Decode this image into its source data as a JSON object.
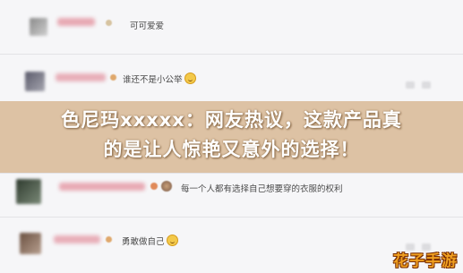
{
  "comments": [
    {
      "text": "可可爱爱",
      "has_emoji": false
    },
    {
      "text": "谁还不是小公举",
      "has_emoji": true,
      "emoji": "cat-face-icon"
    },
    {
      "text": "每一个人都有选择自己想要穿的衣服的权利",
      "has_emoji": false
    },
    {
      "text": "勇敢做自己",
      "has_emoji": true,
      "emoji": "smiley-face-icon"
    }
  ],
  "banner": {
    "line1": "色尼玛xxxxx：网友热议，这款产品真",
    "line2": "的是让人惊艳又意外的选择！"
  },
  "watermark": "花子手游",
  "colors": {
    "banner_bg": "#d6b48c",
    "banner_text": "#ffffff",
    "watermark": "#f0a020"
  }
}
